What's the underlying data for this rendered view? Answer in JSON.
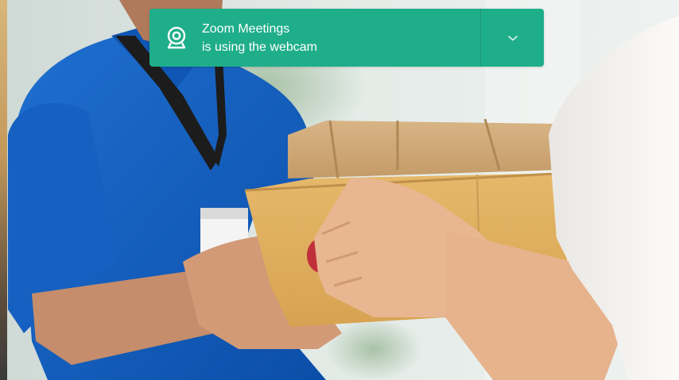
{
  "notification": {
    "app_name": "Zoom Meetings",
    "message": "is using the webcam",
    "icon": "webcam-icon",
    "expand_icon": "chevron-down-icon",
    "color": "#1fae8a"
  },
  "background": {
    "description_icon": "delivery-photo"
  }
}
